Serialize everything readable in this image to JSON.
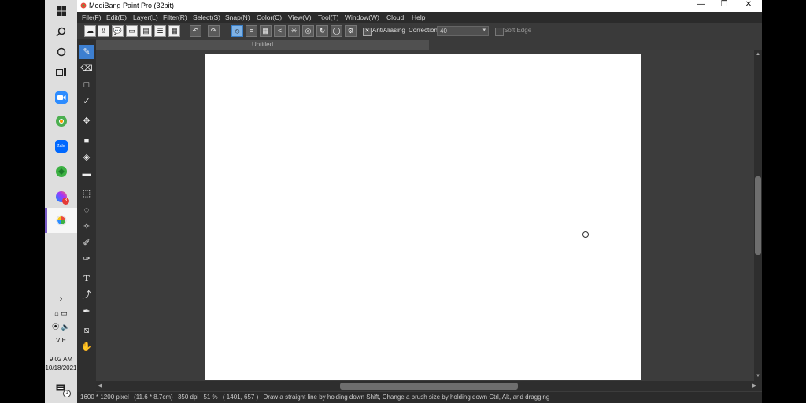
{
  "taskbar": {
    "icons": [
      "windows-start-icon",
      "search-icon",
      "cortana-icon",
      "task-view-icon",
      "zoom-app-icon",
      "chrome-like-app-icon",
      "zalo-app-icon",
      "green-app-icon",
      "messenger-app-icon",
      "medibang-app-icon"
    ],
    "zalo_label": "Zalo",
    "messenger_badge": "3",
    "language": "VIE",
    "time": "9:02 AM",
    "date": "10/18/2021",
    "notification_badge": "1"
  },
  "window": {
    "title": "MediBang Paint Pro (32bit)",
    "controls": {
      "minimize": "—",
      "restore": "❐",
      "close": "✕"
    }
  },
  "menu": [
    "File(F)",
    "Edit(E)",
    "Layer(L)",
    "Filter(R)",
    "Select(S)",
    "Snap(N)",
    "Color(C)",
    "View(V)",
    "Tool(T)",
    "Window(W)",
    "Cloud",
    "Help"
  ],
  "toolbar": {
    "antialiasing_label": "AntiAliasing",
    "antialiasing_checked": true,
    "correction_label": "Correction",
    "correction_value": "40",
    "soft_edge_label": "Soft Edge",
    "soft_edge_checked": false
  },
  "document": {
    "tab_title": "Untitled"
  },
  "status": {
    "size_pixel": "1600 * 1200 pixel",
    "size_cm": "(11.6 * 8.7cm)",
    "dpi": "350 dpi",
    "zoom": "51 %",
    "cursor": "( 1401, 657 )",
    "hint": "Draw a straight line by holding down Shift, Change a brush size by holding down Ctrl, Alt, and dragging"
  },
  "colors": {
    "accent": "#3d7fd0",
    "canvas": "#ffffff",
    "workspace": "#3c3c3c"
  }
}
